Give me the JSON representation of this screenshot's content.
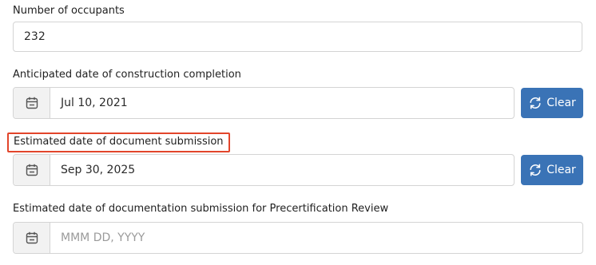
{
  "fields": [
    {
      "label": "Number of occupants",
      "value": "232"
    },
    {
      "label": "Anticipated date of construction completion",
      "value": "Jul 10, 2021",
      "clear_label": "Clear"
    },
    {
      "label": "Estimated date of document submission",
      "value": "Sep 30, 2025",
      "clear_label": "Clear"
    },
    {
      "label": "Estimated date of documentation submission for Precertification Review",
      "placeholder": "MMM DD, YYYY"
    }
  ],
  "icons": {
    "calendar": "calendar-icon",
    "clear": "refresh-icon"
  },
  "colors": {
    "button_bg": "#3a73b6",
    "highlight_border": "#e2452b",
    "addon_bg": "#f2f2f2",
    "border": "#d4d4d4"
  }
}
